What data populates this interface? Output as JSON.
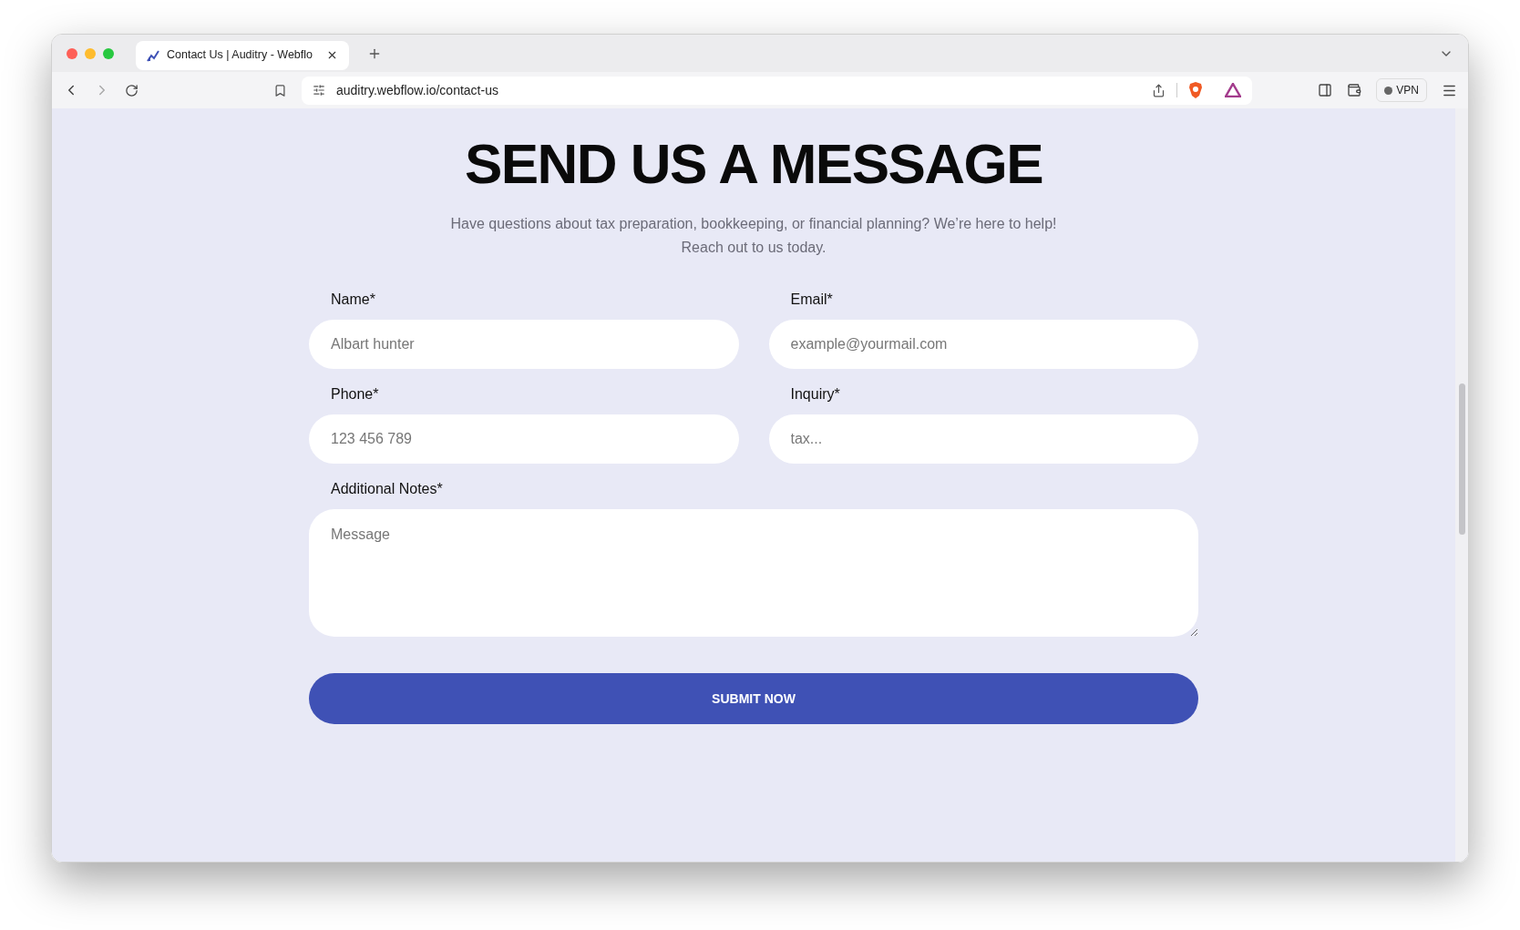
{
  "browser": {
    "tab": {
      "title": "Contact Us | Auditry - Webflo",
      "selected": true
    },
    "url": "auditry.webflow.io/contact-us",
    "vpn": "VPN"
  },
  "page": {
    "heading": "SEND US A MESSAGE",
    "subtitle_lines": [
      "Have questions about tax preparation, bookkeeping, or financial planning? We’re here to help!",
      "Reach out to us today."
    ],
    "fields": [
      {
        "label": "Name*",
        "placeholder": "Albart hunter"
      },
      {
        "label": "Email*",
        "placeholder": "example@yourmail.com"
      },
      {
        "label": "Phone*",
        "placeholder": "123 456 789"
      },
      {
        "label": "Inquiry*",
        "placeholder": "tax..."
      }
    ],
    "notes": {
      "label": "Additional Notes*",
      "placeholder": "Message"
    },
    "submit": "SUBMIT NOW"
  }
}
